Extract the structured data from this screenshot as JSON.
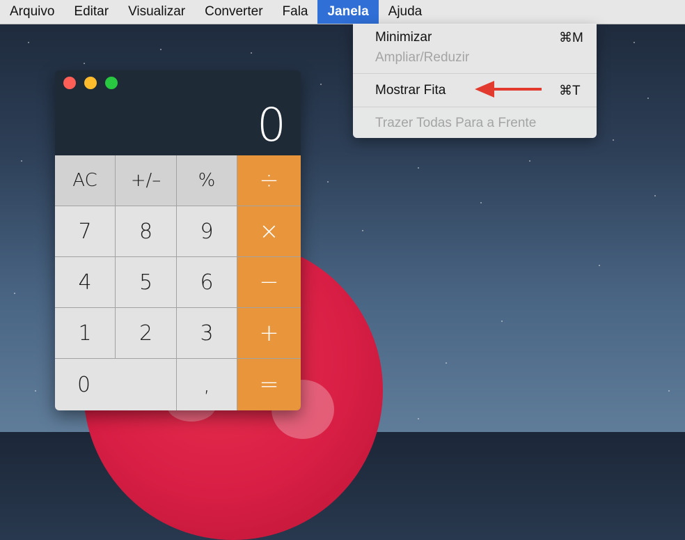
{
  "menubar": {
    "items": [
      "Arquivo",
      "Editar",
      "Visualizar",
      "Converter",
      "Fala",
      "Janela",
      "Ajuda"
    ],
    "active": "Janela"
  },
  "janela_menu": {
    "minimize": {
      "label": "Minimizar",
      "shortcut": "⌘M"
    },
    "zoom": {
      "label": "Ampliar/Reduzir"
    },
    "show_tape": {
      "label": "Mostrar Fita",
      "shortcut": "⌘T"
    },
    "bring_all": {
      "label": "Trazer Todas Para a Frente"
    }
  },
  "calculator": {
    "display": "0",
    "keys": {
      "ac": "AC",
      "sign": "+/–",
      "percent": "%",
      "divide": "÷",
      "seven": "7",
      "eight": "8",
      "nine": "9",
      "multiply": "×",
      "four": "4",
      "five": "5",
      "six": "6",
      "minus": "−",
      "one": "1",
      "two": "2",
      "three": "3",
      "plus": "+",
      "zero": "0",
      "decimal": ",",
      "equals": "="
    }
  },
  "colors": {
    "menu_highlight": "#2f6fd6",
    "operator_orange": "#e8953c",
    "arrow_red": "#e23a2e"
  }
}
